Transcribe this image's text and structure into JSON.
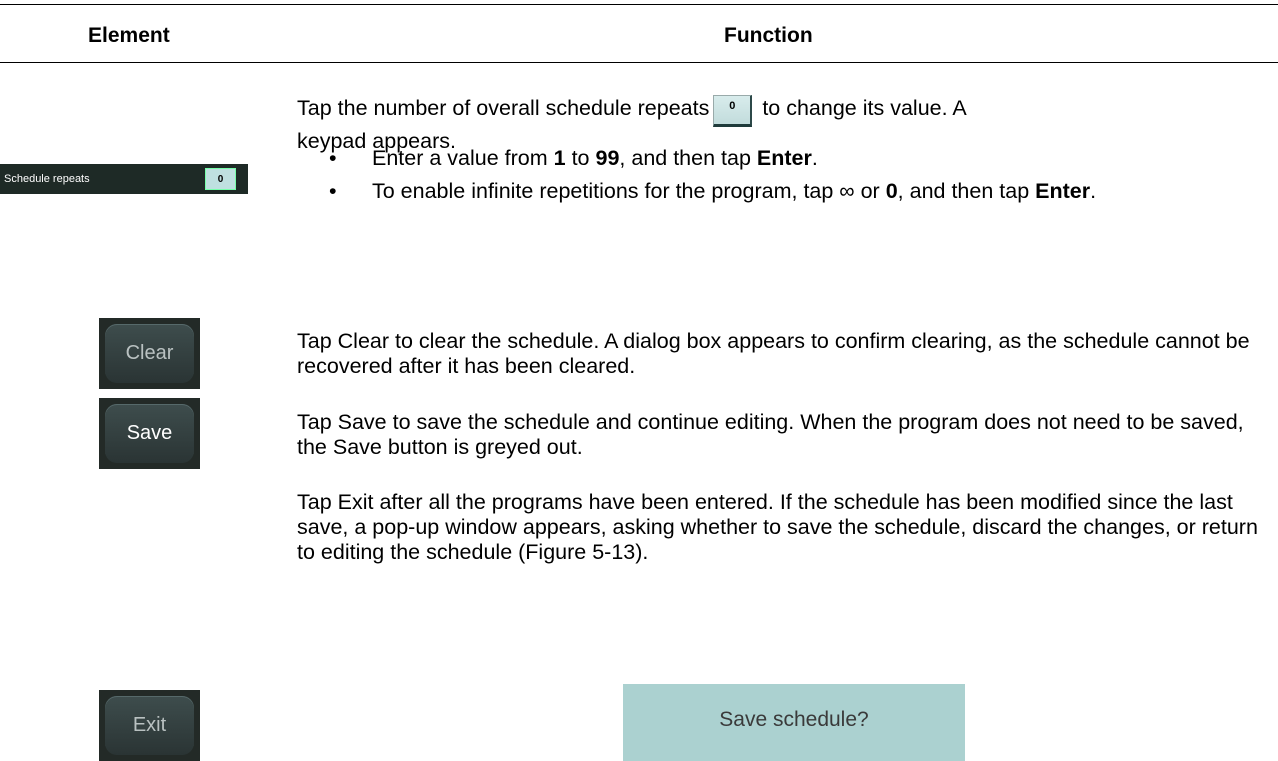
{
  "table": {
    "header_element": "Element",
    "header_function": "Function"
  },
  "rows": {
    "schedule_repeats": {
      "widget_label": "Schedule repeats",
      "widget_value": "0",
      "inline_value": "0",
      "text_before_box": "Tap the number of overall schedule repeats",
      "text_after_box": " to change its value. A",
      "text_line2": "keypad appears.",
      "bullet1": {
        "p1": "Enter a value from ",
        "b1": "1",
        "p2": " to ",
        "b2": "99",
        "p3": ", and then tap ",
        "b3": "Enter",
        "p4": "."
      },
      "bullet2": {
        "p1": "To enable infinite repetitions for the program, tap ∞ or ",
        "b1": "0",
        "p2": ", and then tap ",
        "b2": "Enter",
        "p3": "."
      }
    },
    "clear": {
      "button_label": "Clear",
      "text": "Tap Clear to clear the schedule. A dialog box appears to confirm clearing, as the schedule cannot be recovered after it has been cleared."
    },
    "save": {
      "button_label": "Save",
      "text": "Tap Save to save the schedule and continue editing. When the program does not need to be saved, the Save button is greyed out."
    },
    "exit": {
      "button_label": "Exit",
      "text": "Tap Exit after all the programs have been entered. If the schedule has been modified since the last save, a pop-up window appears, asking whether to save the schedule, discard the changes, or return to editing the schedule (Figure 5-13).",
      "dialog_text": "Save schedule?"
    }
  },
  "colors": {
    "button_bg": "#2f3a3a",
    "widget_bg": "#1e2a26",
    "value_box": "#bfe0e0",
    "dialog_bg": "#abd1d0"
  }
}
